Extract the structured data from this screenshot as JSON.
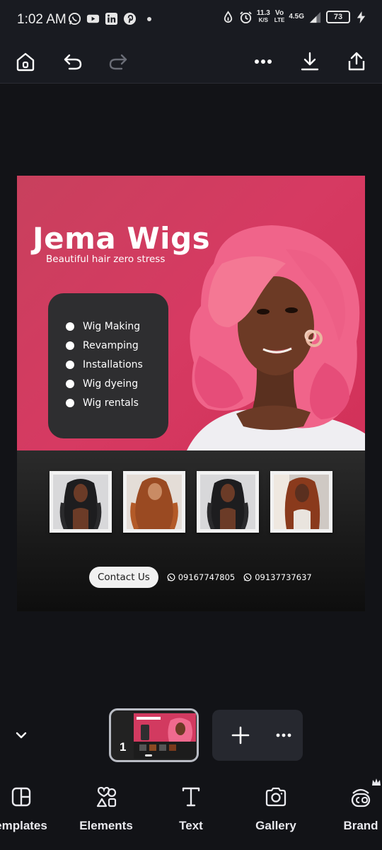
{
  "status_bar": {
    "time": "1:02 AM",
    "network_speed_value": "11.3",
    "network_speed_unit": "K/S",
    "volte_top": "Vo",
    "volte_bottom": "LTE",
    "network_type": "4.5G",
    "battery_level": "73"
  },
  "design": {
    "title": "Jema Wigs",
    "tagline": "Beautiful hair zero stress",
    "services": [
      "Wig Making",
      "Revamping",
      "Installations",
      "Wig dyeing",
      "Wig rentals"
    ],
    "contact_label": "Contact Us",
    "phone_1": "09167747805",
    "phone_2": "09137737637"
  },
  "pages": {
    "current_page_number": "1"
  },
  "bottom_nav": {
    "items": [
      {
        "label": "emplates",
        "icon": "templates-icon"
      },
      {
        "label": "Elements",
        "icon": "elements-icon"
      },
      {
        "label": "Text",
        "icon": "text-icon"
      },
      {
        "label": "Gallery",
        "icon": "camera-icon"
      },
      {
        "label": "Brand",
        "icon": "brand-icon"
      }
    ]
  }
}
